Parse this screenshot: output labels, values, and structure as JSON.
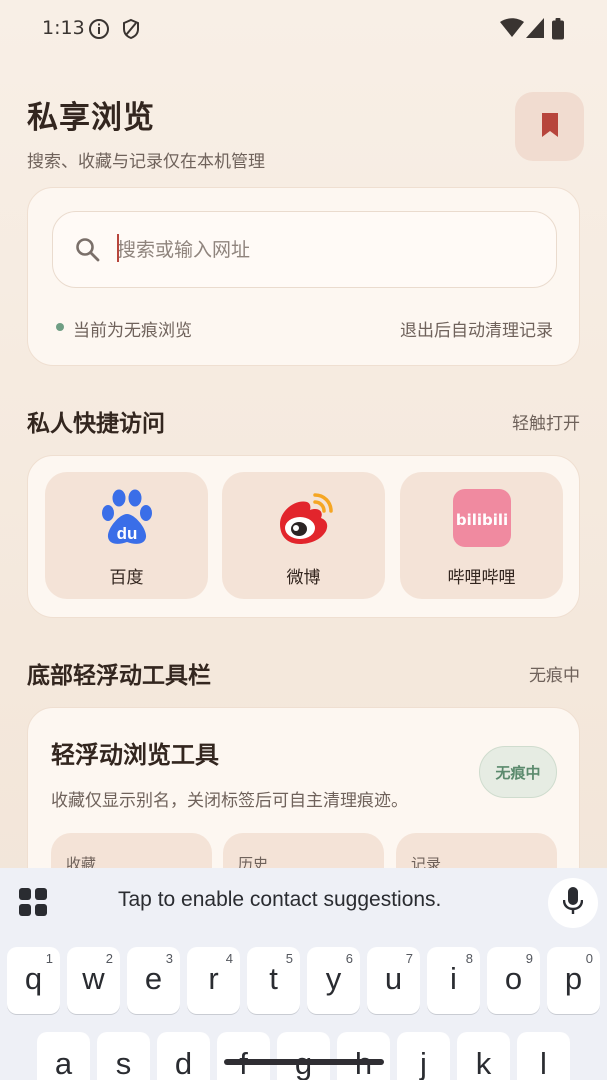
{
  "status_bar": {
    "time": "1:13",
    "icons": [
      "info-icon",
      "shield-icon",
      "wifi-icon",
      "cell-signal-icon",
      "battery-icon"
    ]
  },
  "header": {
    "title": "私享浏览",
    "subtitle": "搜索、收藏与记录仅在本机管理",
    "bookmark_icon": "bookmark-icon"
  },
  "search": {
    "placeholder": "搜索或输入网址",
    "value": "",
    "status_text": "当前为无痕浏览",
    "status_right": "退出后自动清理记录",
    "status_dot_color": "#6f9e84"
  },
  "quick_access": {
    "title": "私人快捷访问",
    "aside": "轻触打开",
    "items": [
      {
        "label": "百度",
        "icon": "baidu-logo-icon"
      },
      {
        "label": "微博",
        "icon": "weibo-logo-icon"
      },
      {
        "label": "哔哩哔哩",
        "icon": "bilibili-logo-icon",
        "icon_text": "bilibili"
      }
    ]
  },
  "toolbar_section": {
    "title": "底部轻浮动工具栏",
    "aside": "无痕中",
    "card_title": "轻浮动浏览工具",
    "card_desc": "收藏仅显示别名，关闭标签后可自主清理痕迹。",
    "badge": "无痕中",
    "mini_items": [
      "收藏",
      "历史",
      "记录"
    ]
  },
  "keyboard": {
    "suggestion": "Tap to enable contact suggestions.",
    "row1": [
      {
        "letter": "q",
        "num": "1"
      },
      {
        "letter": "w",
        "num": "2"
      },
      {
        "letter": "e",
        "num": "3"
      },
      {
        "letter": "r",
        "num": "4"
      },
      {
        "letter": "t",
        "num": "5"
      },
      {
        "letter": "y",
        "num": "6"
      },
      {
        "letter": "u",
        "num": "7"
      },
      {
        "letter": "i",
        "num": "8"
      },
      {
        "letter": "o",
        "num": "9"
      },
      {
        "letter": "p",
        "num": "0"
      }
    ],
    "row2": [
      "a",
      "s",
      "d",
      "f",
      "g",
      "h",
      "j",
      "k",
      "l"
    ]
  },
  "colors": {
    "accent": "#b7453c",
    "green": "#5b8a6d",
    "background": "#f8efe6"
  }
}
